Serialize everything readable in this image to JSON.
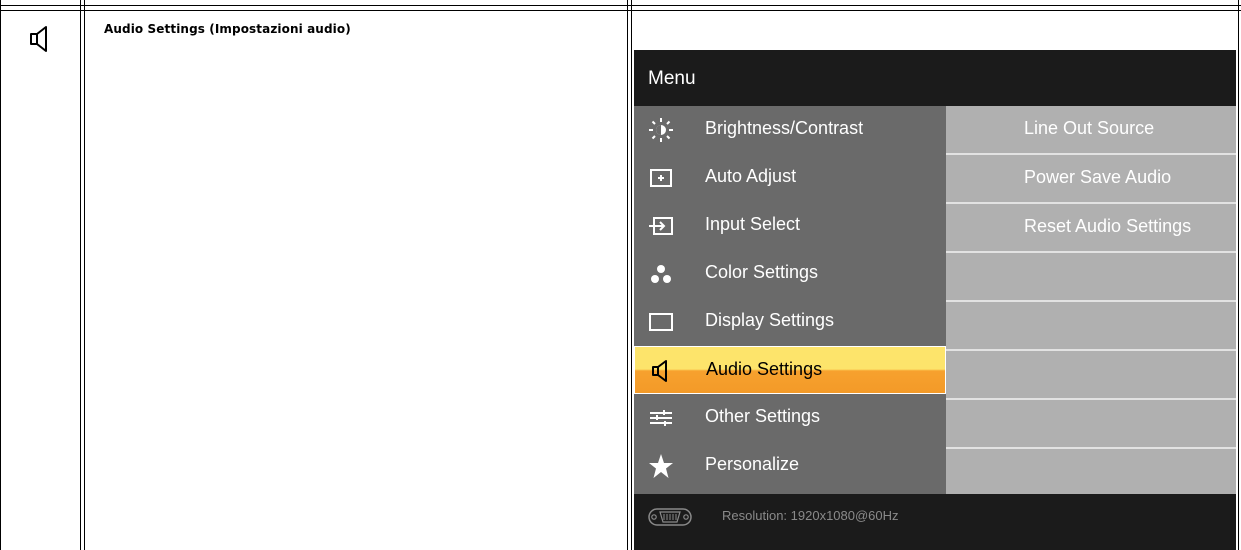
{
  "doc": {
    "section_title": "Audio Settings (Impostazioni audio)"
  },
  "osd": {
    "title": "Menu",
    "menu_items": [
      {
        "label": "Brightness/Contrast",
        "icon": "brightness-icon"
      },
      {
        "label": "Auto Adjust",
        "icon": "auto-adjust-icon"
      },
      {
        "label": "Input Select",
        "icon": "input-select-icon"
      },
      {
        "label": "Color Settings",
        "icon": "color-settings-icon"
      },
      {
        "label": "Display Settings",
        "icon": "display-settings-icon"
      },
      {
        "label": "Audio Settings",
        "icon": "speaker-icon",
        "active": true
      },
      {
        "label": "Other Settings",
        "icon": "other-settings-icon"
      },
      {
        "label": "Personalize",
        "icon": "star-icon"
      }
    ],
    "sub_items": [
      {
        "label": "Line Out Source"
      },
      {
        "label": "Power Save Audio"
      },
      {
        "label": "Reset Audio Settings"
      },
      {
        "label": ""
      },
      {
        "label": ""
      },
      {
        "label": ""
      },
      {
        "label": ""
      },
      {
        "label": ""
      }
    ],
    "footer": {
      "resolution": "Resolution: 1920x1080@60Hz",
      "icon": "vga-connector-icon"
    }
  },
  "colors": {
    "menu_bg": "#6a6a6a",
    "submenu_bg": "#b0b0b0",
    "osd_dark": "#1b1b1b",
    "highlight_top": "#fde46b",
    "highlight_bottom": "#f39a28"
  }
}
